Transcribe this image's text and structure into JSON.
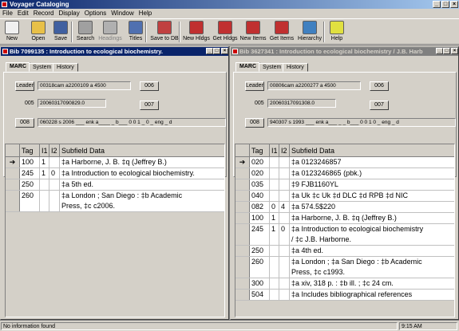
{
  "window": {
    "title": "Voyager Cataloging",
    "controls": [
      "_",
      "□",
      "×"
    ]
  },
  "menu": [
    "File",
    "Edit",
    "Record",
    "Display",
    "Options",
    "Window",
    "Help"
  ],
  "toolbar": [
    {
      "label": "New",
      "icon": "new-document-icon",
      "color": "#f0f0f0",
      "enabled": true
    },
    {
      "label": "Open",
      "icon": "open-folder-icon",
      "color": "#e8c048",
      "enabled": true
    },
    {
      "label": "Save",
      "icon": "save-disk-icon",
      "color": "#4060a0",
      "enabled": true
    },
    {
      "label": "Search",
      "icon": "search-icon",
      "color": "#a0a0a0",
      "enabled": true
    },
    {
      "label": "Headings",
      "icon": "headings-icon",
      "color": "#b0b0b0",
      "enabled": false
    },
    {
      "label": "Titles",
      "icon": "titles-icon",
      "color": "#5070b0",
      "enabled": true
    },
    {
      "label": "Save to DB",
      "icon": "save-to-db-icon",
      "color": "#c04040",
      "enabled": true
    },
    {
      "label": "New Hldgs",
      "icon": "new-holdings-icon",
      "color": "#c03030",
      "enabled": true
    },
    {
      "label": "Get Hldgs",
      "icon": "get-holdings-icon",
      "color": "#c03030",
      "enabled": true
    },
    {
      "label": "New Items",
      "icon": "new-items-icon",
      "color": "#c03030",
      "enabled": true
    },
    {
      "label": "Get Items",
      "icon": "get-items-icon",
      "color": "#c03030",
      "enabled": true
    },
    {
      "label": "Hierarchy",
      "icon": "hierarchy-icon",
      "color": "#4080c0",
      "enabled": true
    },
    {
      "label": "Help",
      "icon": "help-icon",
      "color": "#e0e040",
      "enabled": true
    }
  ],
  "left": {
    "title": "Bib 7099135 : Introduction to ecological biochemistry.",
    "tabs": [
      "MARC",
      "System",
      "History"
    ],
    "leader_label": "Leader",
    "leader_value": "00318cam a2200109 a 4500",
    "f005_label": "005",
    "f005_value": "20060317090829.0",
    "f006_label": "006",
    "f007_label": "007",
    "f008_label": "008",
    "f008_value": "060228 s 2006 ___ enk a____ _ b___ 0 0 1 _ 0 _ eng _ d",
    "columns": [
      "Tag",
      "I1",
      "I2",
      "Subfield Data"
    ],
    "rows": [
      {
        "ind": "➔",
        "tag": "100",
        "i1": "1",
        "i2": "",
        "data": "‡a Harborne, J. B. ‡q (Jeffrey B.)",
        "h": 14
      },
      {
        "ind": "",
        "tag": "245",
        "i1": "1",
        "i2": "0",
        "data": "‡a Introduction to ecological biochemistry.",
        "h": 14
      },
      {
        "ind": "",
        "tag": "250",
        "i1": "",
        "i2": "",
        "data": "‡a 5th ed.",
        "h": 14
      },
      {
        "ind": "",
        "tag": "260",
        "i1": "",
        "i2": "",
        "data": "‡a London ;  San Diego : ‡b Academic",
        "data2": "Press, ‡c c2006.",
        "h": 27
      }
    ]
  },
  "right": {
    "title": "Bib 3627341 : Introduction to ecological biochemistry / J.B. Harb",
    "tabs": [
      "MARC",
      "System",
      "History"
    ],
    "leader_label": "Leader",
    "leader_value": "00806cam a2200277 a 4500",
    "f005_label": "005",
    "f005_value": "20060317091308.0",
    "f006_label": "006",
    "f007_label": "007",
    "f008_label": "008",
    "f008_value": "940307 s 1993 ___ enk a___ _ _ b___ 0 0 1 0 _ eng _ d",
    "columns": [
      "Tag",
      "I1",
      "I2",
      "Subfield Data"
    ],
    "rows": [
      {
        "ind": "➔",
        "tag": "020",
        "i1": "",
        "i2": "",
        "data": "‡a 0123246857",
        "h": 14
      },
      {
        "ind": "",
        "tag": "020",
        "i1": "",
        "i2": "",
        "data": "‡a 0123246865 (pbk.)",
        "h": 14
      },
      {
        "ind": "",
        "tag": "035",
        "i1": "",
        "i2": "",
        "data": "‡9 FJB1160YL",
        "h": 14
      },
      {
        "ind": "",
        "tag": "040",
        "i1": "",
        "i2": "",
        "data": "‡a Uk ‡c Uk ‡d DLC ‡d RPB ‡d NIC",
        "h": 14
      },
      {
        "ind": "",
        "tag": "082",
        "i1": "0",
        "i2": "4",
        "data": "‡a 574.5$220",
        "h": 14
      },
      {
        "ind": "",
        "tag": "100",
        "i1": "1",
        "i2": "",
        "data": "‡a Harborne, J. B. ‡q (Jeffrey B.)",
        "h": 14
      },
      {
        "ind": "",
        "tag": "245",
        "i1": "1",
        "i2": "0",
        "data": "‡a Introduction to ecological biochemistry",
        "data2": "/ ‡c J.B. Harborne.",
        "h": 27
      },
      {
        "ind": "",
        "tag": "250",
        "i1": "",
        "i2": "",
        "data": "‡a 4th ed.",
        "h": 14
      },
      {
        "ind": "",
        "tag": "260",
        "i1": "",
        "i2": "",
        "data": "‡a London ; ‡a San Diego : ‡b Academic",
        "data2": "Press, ‡c c1993.",
        "h": 27
      },
      {
        "ind": "",
        "tag": "300",
        "i1": "",
        "i2": "",
        "data": "‡a xiv, 318 p. : ‡b ill. ; ‡c 24 cm.",
        "h": 14
      },
      {
        "ind": "",
        "tag": "504",
        "i1": "",
        "i2": "",
        "data": "‡a Includes bibliographical references",
        "h": 14
      }
    ]
  },
  "status": {
    "message": "No information found",
    "time": "9:15 AM"
  }
}
